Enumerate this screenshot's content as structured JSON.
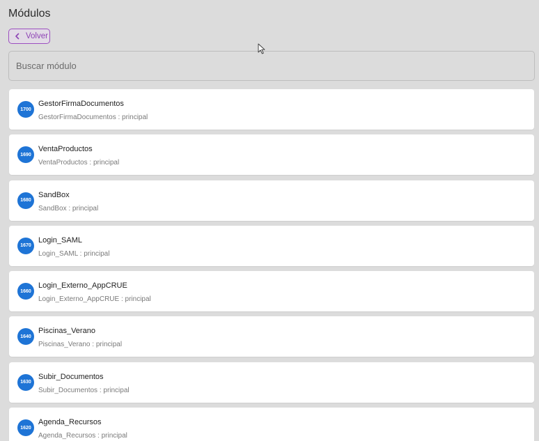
{
  "page": {
    "title": "Módulos",
    "back_label": "Volver",
    "search_placeholder": "Buscar módulo"
  },
  "modules": [
    {
      "id": "1700",
      "name": "GestorFirmaDocumentos",
      "sub": "GestorFirmaDocumentos : principal"
    },
    {
      "id": "1690",
      "name": "VentaProductos",
      "sub": "VentaProductos : principal"
    },
    {
      "id": "1680",
      "name": "SandBox",
      "sub": "SandBox : principal"
    },
    {
      "id": "1670",
      "name": "Login_SAML",
      "sub": "Login_SAML : principal"
    },
    {
      "id": "1660",
      "name": "Login_Externo_AppCRUE",
      "sub": "Login_Externo_AppCRUE : principal"
    },
    {
      "id": "1640",
      "name": "Piscinas_Verano",
      "sub": "Piscinas_Verano : principal"
    },
    {
      "id": "1630",
      "name": "Subir_Documentos",
      "sub": "Subir_Documentos : principal"
    },
    {
      "id": "1620",
      "name": "Agenda_Recursos",
      "sub": "Agenda_Recursos : principal"
    }
  ],
  "colors": {
    "badge": "#1e74d6",
    "accent": "#8e44b5",
    "background": "#dcdcdc"
  },
  "icons": {
    "back": "chevron-left-icon",
    "cursor": "mouse-pointer-icon"
  }
}
